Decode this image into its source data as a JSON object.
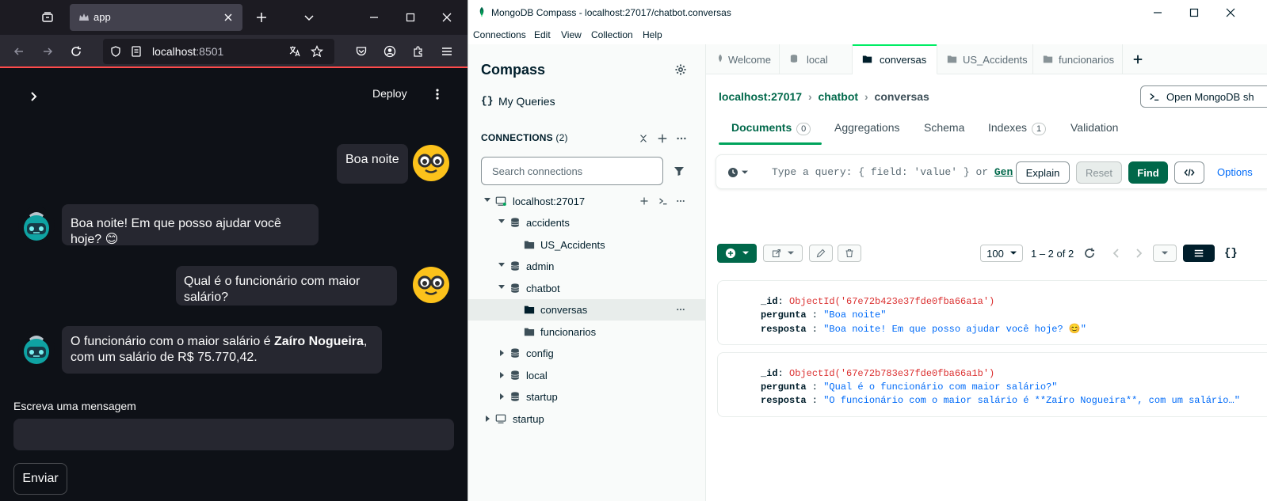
{
  "firefox": {
    "tab_title": "app",
    "url_host": "localhost",
    "url_port": ":8501"
  },
  "streamlit": {
    "deploy_label": "Deploy",
    "messages": [
      {
        "role": "user",
        "text": "Boa noite"
      },
      {
        "role": "assistant",
        "text": "Boa noite! Em que posso ajudar você hoje? 😊"
      },
      {
        "role": "user",
        "text": "Qual é o funcionário com maior salário?"
      },
      {
        "role": "assistant",
        "text_before": "O funcionário com o maior salário é ",
        "text_bold": "Zaíro Nogueira",
        "text_after": ", com um salário de R$ 75.770,42."
      }
    ],
    "input_label": "Escreva uma mensagem",
    "input_value": "",
    "send_label": "Enviar"
  },
  "compass": {
    "window_title": "MongoDB Compass - localhost:27017/chatbot.conversas",
    "menu": [
      "Connections",
      "Edit",
      "View",
      "Collection",
      "Help"
    ],
    "sidebar": {
      "title": "Compass",
      "my_queries": "My Queries",
      "connections_label": "CONNECTIONS",
      "connections_count": "(2)",
      "search_placeholder": "Search connections",
      "tree": [
        {
          "label": "localhost:27017",
          "kind": "connection",
          "expanded": true
        },
        {
          "label": "accidents",
          "kind": "database",
          "expanded": true
        },
        {
          "label": "US_Accidents",
          "kind": "collection"
        },
        {
          "label": "admin",
          "kind": "database",
          "expanded": true
        },
        {
          "label": "chatbot",
          "kind": "database",
          "expanded": true
        },
        {
          "label": "conversas",
          "kind": "collection",
          "selected": true
        },
        {
          "label": "funcionarios",
          "kind": "collection"
        },
        {
          "label": "config",
          "kind": "database",
          "expanded": false
        },
        {
          "label": "local",
          "kind": "database",
          "expanded": false
        },
        {
          "label": "startup",
          "kind": "database",
          "expanded": false
        },
        {
          "label": "startup",
          "kind": "connection",
          "expanded": false
        }
      ]
    },
    "tabs": [
      {
        "label": "Welcome",
        "icon": "leaf-icon"
      },
      {
        "label": "local",
        "icon": "database-icon"
      },
      {
        "label": "conversas",
        "icon": "folder-icon",
        "active": true
      },
      {
        "label": "US_Accidents",
        "icon": "folder-icon"
      },
      {
        "label": "funcionarios",
        "icon": "folder-icon"
      }
    ],
    "breadcrumb": {
      "host": "localhost:27017",
      "db": "chatbot",
      "collection": "conversas"
    },
    "open_shell_label": "Open MongoDB sh",
    "subtabs": [
      {
        "label": "Documents",
        "count": "0",
        "active": true
      },
      {
        "label": "Aggregations"
      },
      {
        "label": "Schema"
      },
      {
        "label": "Indexes",
        "count": "1"
      },
      {
        "label": "Validation"
      }
    ],
    "query": {
      "placeholder": "Type a query: { field: 'value' } or ",
      "gen_link": "Gen",
      "explain": "Explain",
      "reset": "Reset",
      "find": "Find",
      "options": "Options"
    },
    "pagination": {
      "page_size": "100",
      "range": "1 – 2 of 2"
    },
    "documents": [
      {
        "id": "ObjectId('67e72b423e37fde0fba66a1a')",
        "pergunta": "\"Boa noite\"",
        "resposta": "\"Boa noite! Em que posso ajudar você hoje? 😊\""
      },
      {
        "id": "ObjectId('67e72b783e37fde0fba66a1b')",
        "pergunta": "\"Qual é o funcionário com maior salário?\"",
        "resposta": "\"O funcionário com o maior salário é **Zaíro Nogueira**, com um salário…\""
      }
    ],
    "field_names": {
      "id": "_id",
      "pergunta": "pergunta",
      "resposta": "resposta"
    }
  }
}
